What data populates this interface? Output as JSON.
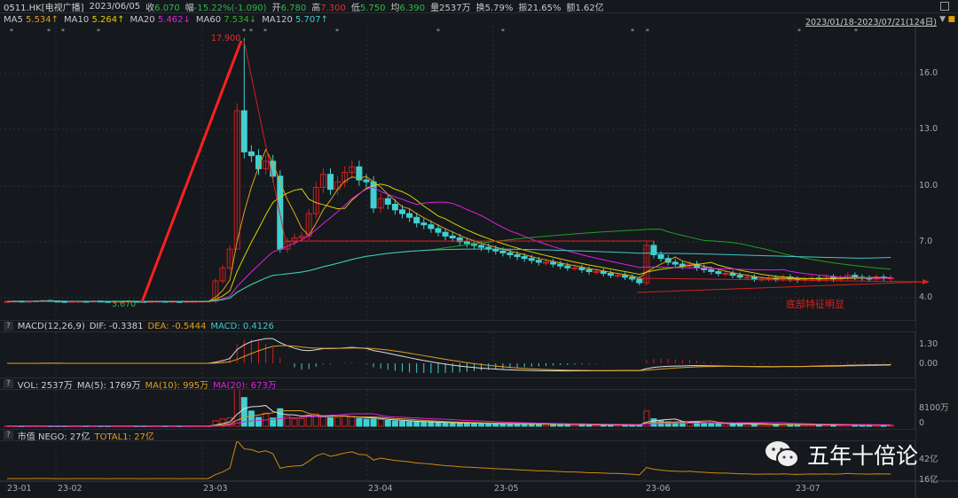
{
  "header": {
    "symbol": "0511.HK[电视广播]",
    "date": "2023/06/05",
    "close_label": "收",
    "close": "6.070",
    "change_label": "幅",
    "change": "-15.22%(-1.090)",
    "open_label": "开",
    "open": "6.780",
    "high_label": "高",
    "high": "7.300",
    "low_label": "低",
    "low": "5.750",
    "avg_label": "均",
    "avg": "6.390",
    "vol_label": "量",
    "vol": "2537万",
    "turnover_label": "换",
    "turnover": "5.79%",
    "amp_label": "振",
    "amp": "21.65%",
    "amount_label": "额",
    "amount": "1.62亿"
  },
  "ma": {
    "ma5_label": "MA5",
    "ma5": "5.534↑",
    "ma10_label": "MA10",
    "ma10": "5.264↑",
    "ma20_label": "MA20",
    "ma20": "5.462↓",
    "ma60_label": "MA60",
    "ma60": "7.534↓",
    "ma120_label": "MA120",
    "ma120": "5.707↑"
  },
  "range": "2023/01/18-2023/07/21(124日)",
  "macd": {
    "help": "?",
    "title": "MACD(12,26,9)",
    "dif": "DIF: -0.3381",
    "dea": "DEA: -0.5444",
    "macd": "MACD: 0.4126",
    "ticks": [
      "1.30",
      "0.00"
    ]
  },
  "vol": {
    "help": "?",
    "title": "VOL: 2537万",
    "ma5": "MA(5): 1769万",
    "ma10": "MA(10): 995万",
    "ma20": "MA(20): 673万",
    "ticks": [
      "8100万",
      "0"
    ]
  },
  "nego": {
    "help": "?",
    "title": "市值 NEGO: 27亿",
    "total": "TOTAL1: 27亿",
    "ticks": [
      "42亿",
      "16亿"
    ]
  },
  "price_ticks": [
    "16.0",
    "13.0",
    "10.0",
    "7.0",
    "4.0"
  ],
  "annotations": {
    "high": "17.900",
    "low": "3.670",
    "note": "底部特征明显"
  },
  "xlabels": [
    "23-01",
    "23-02",
    "23-03",
    "23-04",
    "23-05",
    "23-06",
    "23-07"
  ],
  "watermark": "五年十倍论",
  "colors": {
    "up": "#d02020",
    "down": "#40d0d0",
    "ma5": "#e0a020",
    "ma10": "#d8d000",
    "ma20": "#e020e0",
    "ma60": "#20a020",
    "ma120": "#40c8c8"
  },
  "chart_data": {
    "type": "candlestick",
    "closes": [
      3.8,
      3.82,
      3.8,
      3.81,
      3.83,
      3.85,
      3.82,
      3.8,
      3.79,
      3.8,
      3.81,
      3.8,
      3.82,
      3.8,
      3.79,
      3.8,
      3.8,
      3.81,
      3.8,
      3.79,
      3.8,
      3.81,
      3.8,
      3.8,
      3.79,
      3.8,
      3.8,
      3.81,
      3.82,
      4.9,
      5.6,
      6.6,
      14.0,
      11.8,
      11.6,
      10.9,
      11.3,
      10.5,
      6.6,
      7.0,
      7.2,
      7.3,
      8.5,
      9.9,
      10.6,
      9.8,
      10.2,
      10.7,
      11.0,
      10.3,
      10.2,
      8.8,
      9.3,
      9.0,
      8.7,
      8.5,
      8.3,
      8.0,
      7.9,
      7.7,
      7.5,
      7.3,
      7.2,
      7.0,
      6.9,
      6.8,
      6.7,
      6.6,
      6.5,
      6.4,
      6.3,
      6.2,
      6.1,
      6.0,
      5.9,
      5.9,
      5.8,
      5.7,
      5.6,
      5.6,
      5.5,
      5.4,
      5.4,
      5.3,
      5.2,
      5.2,
      5.1,
      5.0,
      4.8,
      6.8,
      6.3,
      6.1,
      5.9,
      5.8,
      5.7,
      5.8,
      5.6,
      5.5,
      5.4,
      5.3,
      5.3,
      5.2,
      5.1,
      5.1,
      5.0,
      5.0,
      5.05,
      5.0,
      5.1,
      5.0,
      4.95,
      5.0,
      5.05,
      5.0,
      5.1,
      5.0,
      5.05,
      5.2,
      5.1,
      5.05,
      5.0,
      5.1,
      5.05,
      5.07
    ],
    "volumes": [
      20,
      30,
      20,
      25,
      40,
      30,
      20,
      15,
      20,
      20,
      25,
      20,
      30,
      20,
      15,
      20,
      20,
      25,
      20,
      15,
      20,
      25,
      20,
      20,
      15,
      20,
      20,
      25,
      30,
      1900,
      2500,
      2900,
      13000,
      9800,
      5200,
      3000,
      4500,
      2800,
      6000,
      3500,
      2500,
      2600,
      3800,
      4200,
      3600,
      2900,
      3000,
      3500,
      3300,
      2600,
      2400,
      2500,
      2300,
      2000,
      1800,
      1700,
      1600,
      1500,
      1400,
      1300,
      1200,
      1200,
      1100,
      1100,
      1000,
      1000,
      950,
      900,
      900,
      850,
      800,
      800,
      750,
      700,
      700,
      650,
      650,
      600,
      600,
      550,
      550,
      500,
      500,
      450,
      450,
      400,
      400,
      380,
      600,
      5200,
      2537,
      1800,
      1500,
      1300,
      1200,
      1100,
      1600,
      1000,
      900,
      850,
      800,
      800,
      750,
      700,
      700,
      650,
      650,
      600,
      600,
      550,
      550,
      500,
      500,
      480,
      460,
      450,
      440,
      430,
      420,
      410,
      400,
      400,
      390,
      380
    ],
    "ylim": [
      3.5,
      18.5
    ]
  }
}
